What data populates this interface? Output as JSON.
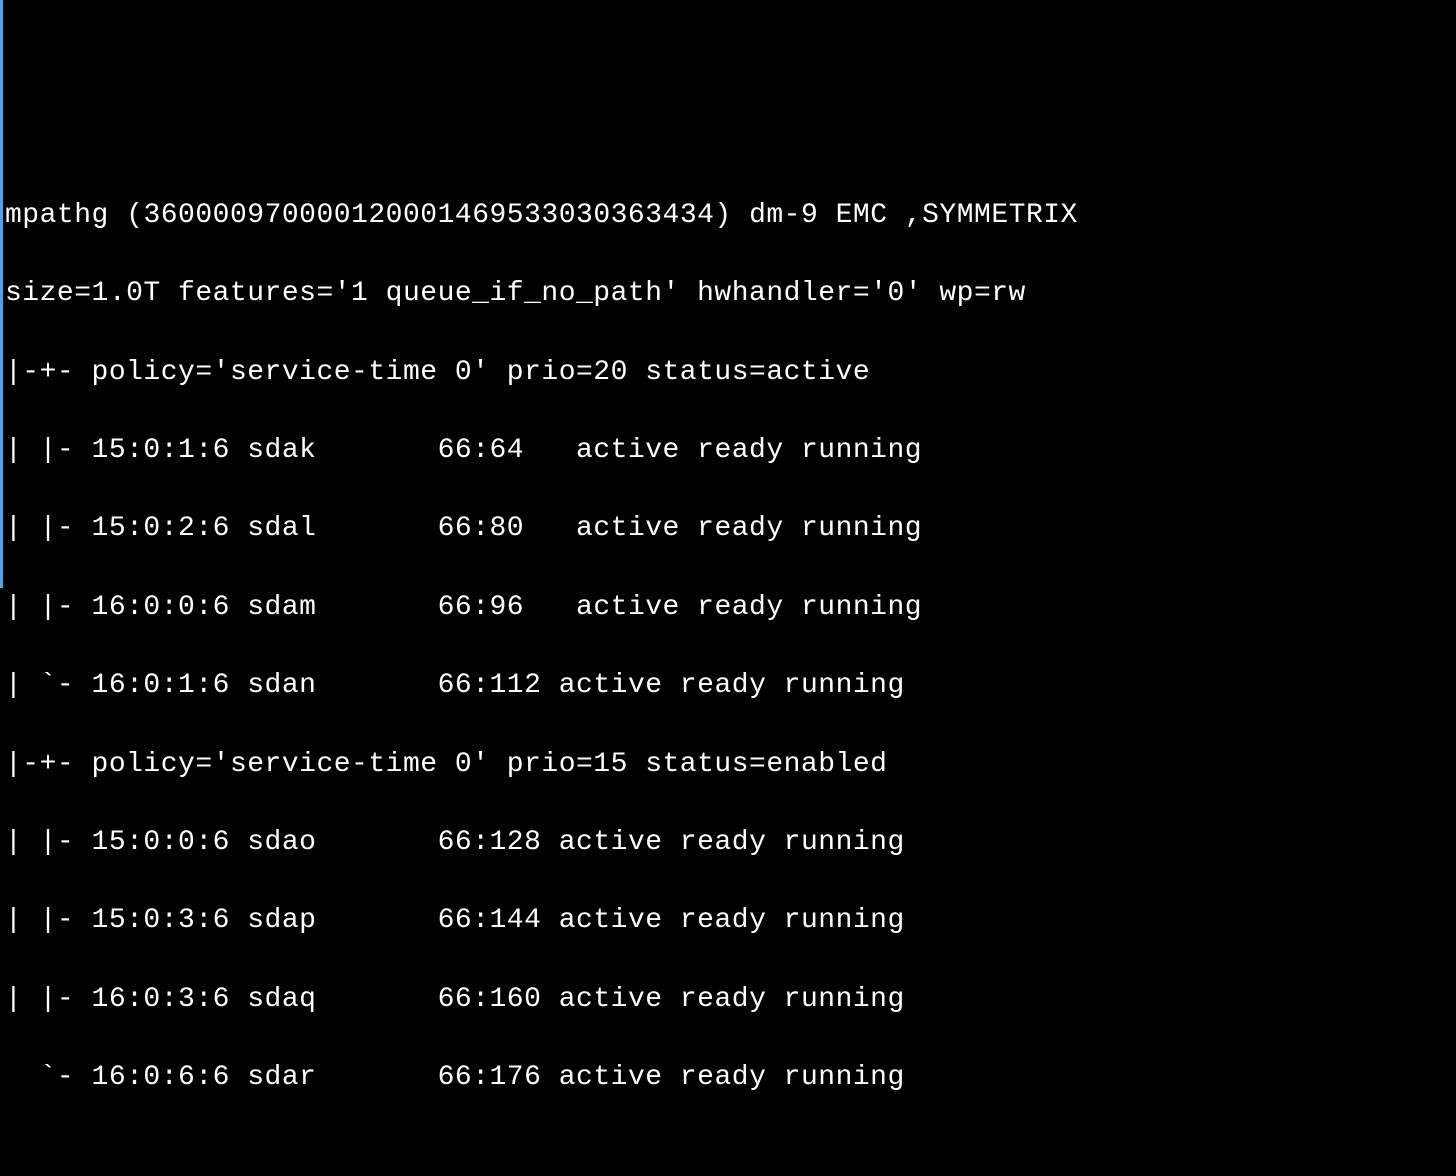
{
  "header": {
    "name": "mpathg",
    "wwid": "(360000970000120001469533030363434)",
    "dm": "dm-9",
    "vendor": "EMC",
    "product": ",SYMMETRIX"
  },
  "info": "size=1.0T features='1 queue_if_no_path' hwhandler='0' wp=rw",
  "groups": [
    {
      "prefix": "|-+- ",
      "policy": "policy='service-time 0' prio=20 status=active",
      "paths": [
        {
          "prefix": "| |- ",
          "hctl": "15:0:1:6",
          "dev": "sdak",
          "mm": "66:64 ",
          "state": "active ready running"
        },
        {
          "prefix": "| |- ",
          "hctl": "15:0:2:6",
          "dev": "sdal",
          "mm": "66:80 ",
          "state": "active ready running"
        },
        {
          "prefix": "| |- ",
          "hctl": "16:0:0:6",
          "dev": "sdam",
          "mm": "66:96 ",
          "state": "active ready running"
        },
        {
          "prefix": "| `- ",
          "hctl": "16:0:1:6",
          "dev": "sdan",
          "mm": "66:112",
          "state": "active ready running"
        }
      ]
    },
    {
      "prefix": "|-+- ",
      "policy": "policy='service-time 0' prio=15 status=enabled",
      "paths": [
        {
          "prefix": "| |- ",
          "hctl": "15:0:0:6",
          "dev": "sdao",
          "mm": "66:128",
          "state": "active ready running"
        },
        {
          "prefix": "| |- ",
          "hctl": "15:0:3:6",
          "dev": "sdap",
          "mm": "66:144",
          "state": "active ready running"
        },
        {
          "prefix": "| |- ",
          "hctl": "16:0:3:6",
          "dev": "sdaq",
          "mm": "66:160",
          "state": "active ready running"
        },
        {
          "prefix": "  `- ",
          "hctl": "16:0:6:6",
          "dev": "sdar",
          "mm": "66:176",
          "state": "active ready running"
        }
      ]
    }
  ]
}
